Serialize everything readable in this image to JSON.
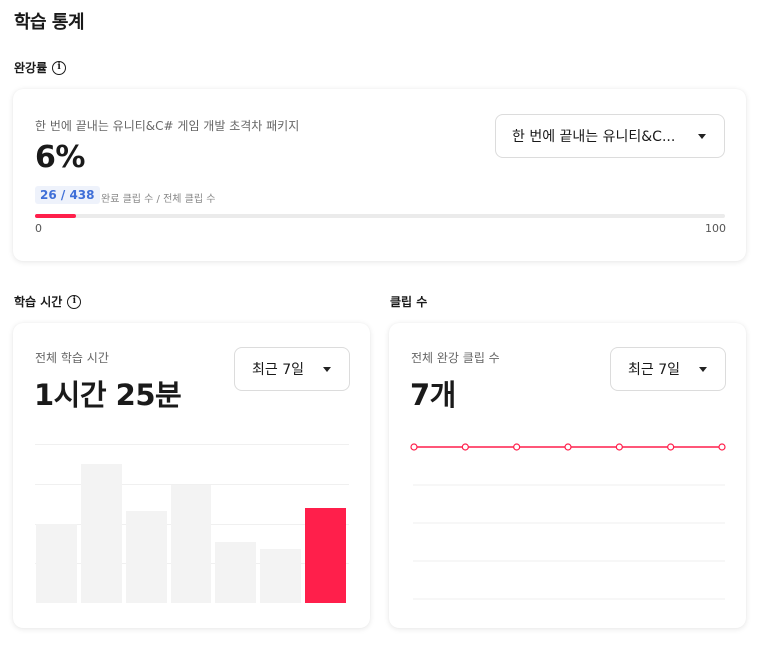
{
  "page_title": "학습 통계",
  "completion": {
    "section_label": "완강률",
    "course_name": "한 번에 끝내는 유니티&C# 게임 개발 초격차 패키지",
    "percent_text": "6%",
    "completed_text": "26 / 438",
    "caption": "완료 클립 수 / 전체 클립 수",
    "progress_fraction": 0.0594,
    "progress_min": "0",
    "progress_max": "100",
    "dropdown_value": "한 번에 끝내는 유니티&C...",
    "accent_color": "#ff1f4b"
  },
  "study_time": {
    "section_label": "학습 시간",
    "card_label": "전체 학습 시간",
    "total_text": "1시간 25분",
    "period_value": "최근 7일",
    "bars": [
      0.53,
      0.93,
      0.62,
      0.79,
      0.41,
      0.36,
      0.64
    ],
    "highlight_index": 6
  },
  "clips": {
    "section_label": "클립 수",
    "card_label": "전체 완강 클립 수",
    "total_text": "7개",
    "period_value": "최근 7일",
    "points": [
      1,
      1,
      1,
      1,
      1,
      1,
      1
    ]
  }
}
